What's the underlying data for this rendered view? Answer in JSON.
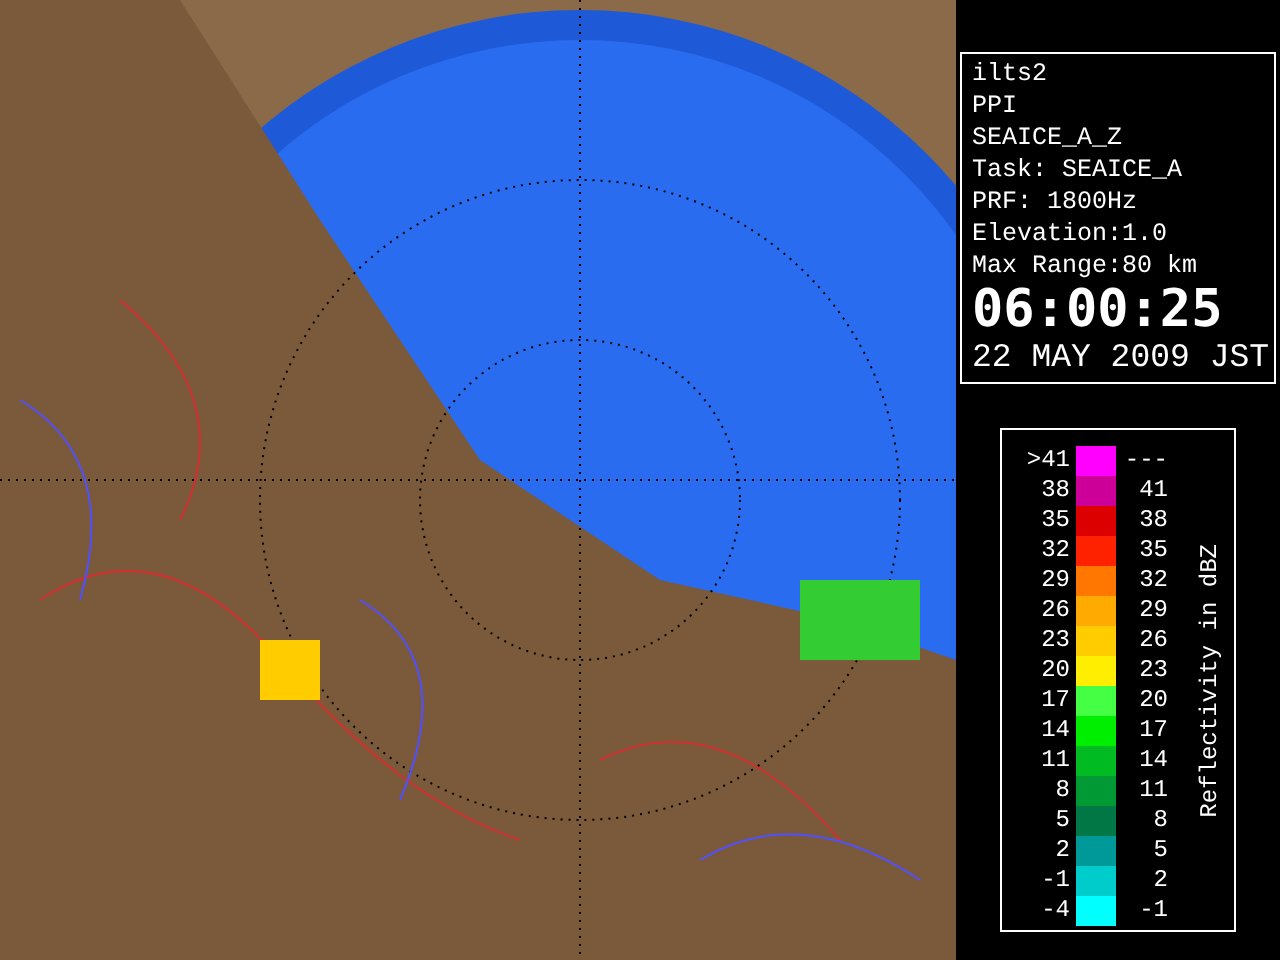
{
  "info": {
    "lines": [
      "ilts2",
      "PPI",
      "SEAICE_A_Z",
      "Task: SEAICE_A",
      "PRF: 1800Hz",
      "Elevation:1.0",
      "Max Range:80 km"
    ],
    "time": "06:00:25",
    "date": "22 MAY 2009 JST"
  },
  "legend": {
    "title": "Reflectivity in dBZ",
    "rows": [
      {
        "low": ">41",
        "high": "---",
        "color": "#ff00ff"
      },
      {
        "low": "38",
        "high": "41",
        "color": "#cc0099"
      },
      {
        "low": "35",
        "high": "38",
        "color": "#dd0000"
      },
      {
        "low": "32",
        "high": "35",
        "color": "#ff2200"
      },
      {
        "low": "29",
        "high": "32",
        "color": "#ff7700"
      },
      {
        "low": "26",
        "high": "29",
        "color": "#ffaa00"
      },
      {
        "low": "23",
        "high": "26",
        "color": "#ffcc00"
      },
      {
        "low": "20",
        "high": "23",
        "color": "#ffee00"
      },
      {
        "low": "17",
        "high": "20",
        "color": "#44ff44"
      },
      {
        "low": "14",
        "high": "17",
        "color": "#00ee00"
      },
      {
        "low": "11",
        "high": "14",
        "color": "#00bb22"
      },
      {
        "low": "8",
        "high": "11",
        "color": "#009933"
      },
      {
        "low": "5",
        "high": "8",
        "color": "#007744"
      },
      {
        "low": "2",
        "high": "5",
        "color": "#009999"
      },
      {
        "low": "-1",
        "high": "2",
        "color": "#00cccc"
      },
      {
        "low": "-4",
        "high": "-1",
        "color": "#00ffff"
      }
    ]
  }
}
